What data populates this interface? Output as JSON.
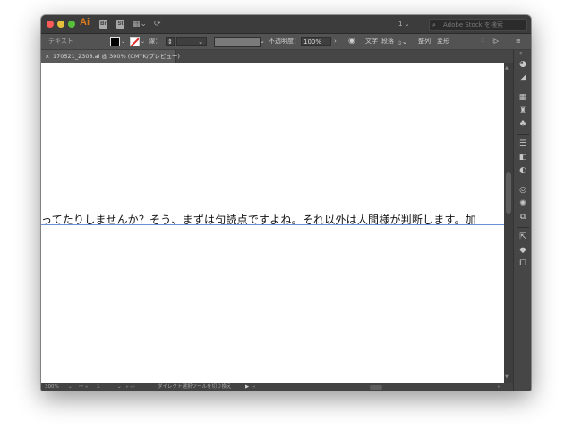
{
  "app": {
    "logo": "Ai",
    "toolbar_badges": [
      "Br",
      "St"
    ],
    "workspace_number": "1",
    "search_placeholder": "Adobe Stock を検索"
  },
  "control_bar": {
    "selection_label": "テキスト",
    "stroke_label": "線：",
    "opacity_label": "不透明度：",
    "opacity_value": "100%",
    "character_label": "文字",
    "paragraph_label": "段落",
    "align_label": "整列",
    "transform_label": "変形"
  },
  "document_tab": {
    "close_glyph": "×",
    "title": "170521_2308.ai @ 300% (CMYK/プレビュー)"
  },
  "canvas": {
    "text": "ってたりしませんか？そう、まずは句読点ですよね。それ以外は人間様が判断します。加"
  },
  "status_bar": {
    "zoom": "300%",
    "artboard": "1",
    "tool_hint": "ダイレクト選択ツールを切り換え"
  },
  "colors": {
    "fill": "#000000",
    "stroke_none_slash": "#e12a2a",
    "text_baseline": "#6b8fd6",
    "logo": "#e07b1a"
  },
  "icons": {
    "dock": [
      "color-icon",
      "color-guide-icon",
      "swatches-icon",
      "brushes-icon",
      "symbols-icon",
      "stroke-icon",
      "gradient-icon",
      "transparency-icon",
      "appearance-icon",
      "graphic-styles-icon",
      "image-trace-icon",
      "asset-export-icon",
      "layers-icon",
      "artboards-icon"
    ]
  }
}
